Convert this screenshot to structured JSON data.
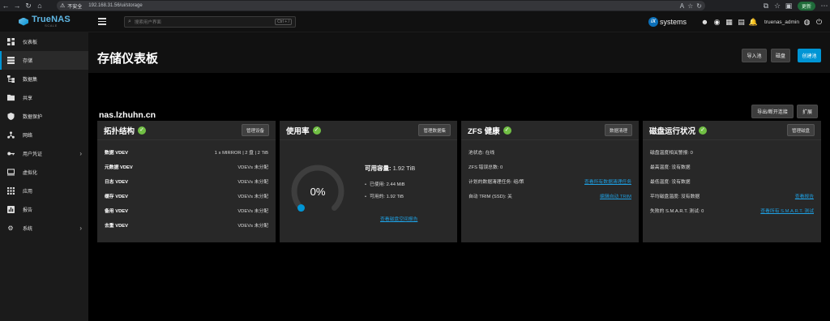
{
  "browser": {
    "security_label": "不安全",
    "url": "192.168.31.56/ui/storage",
    "update_label": "更新"
  },
  "topbar": {
    "logo_name": "TrueNAS",
    "logo_sub": "SCALE",
    "search_placeholder": "搜索用户界面",
    "search_shortcut": "Ctrl + /",
    "brand_ix": "iX",
    "brand_text": "systems",
    "username": "truenas_admin"
  },
  "sidebar": {
    "items": [
      {
        "label": "仪表板",
        "icon": "dashboard-icon"
      },
      {
        "label": "存储",
        "icon": "storage-icon",
        "active": true
      },
      {
        "label": "数据集",
        "icon": "datasets-icon"
      },
      {
        "label": "共享",
        "icon": "shares-icon"
      },
      {
        "label": "数据保护",
        "icon": "data-protection-icon"
      },
      {
        "label": "网络",
        "icon": "network-icon"
      },
      {
        "label": "用户凭证",
        "icon": "credentials-icon",
        "expandable": true
      },
      {
        "label": "虚拟化",
        "icon": "virtualization-icon"
      },
      {
        "label": "应用",
        "icon": "apps-icon"
      },
      {
        "label": "报告",
        "icon": "reporting-icon"
      },
      {
        "label": "系统",
        "icon": "system-icon",
        "expandable": true
      }
    ]
  },
  "page": {
    "title": "存储仪表板",
    "import_pool": "导入池",
    "disks": "磁盘",
    "create_pool": "创建池",
    "pool_name": "nas.lzhuhn.cn",
    "export_disconnect": "导出/断开连接",
    "expand": "扩展"
  },
  "topology": {
    "title": "拓扑结构",
    "button": "管理设备",
    "rows": [
      {
        "label": "数据 VDEV",
        "value": "1 x MIRROR | 2 盘 | 2 TiB"
      },
      {
        "label": "元数据 VDEV",
        "value": "VDEVs 未分配"
      },
      {
        "label": "日志 VDEV",
        "value": "VDEVs 未分配"
      },
      {
        "label": "缓存 VDEV",
        "value": "VDEVs 未分配"
      },
      {
        "label": "备用 VDEV",
        "value": "VDEVs 未分配"
      },
      {
        "label": "去重 VDEV",
        "value": "VDEVs 未分配"
      }
    ]
  },
  "usage": {
    "title": "使用率",
    "button": "管理数据集",
    "percent": "0%",
    "percent_value": 0,
    "capacity_label": "可用容量:",
    "capacity_value": "1.92 TiB",
    "used": "已使用: 2.44 MiB",
    "available": "可用的: 1.92 TiB",
    "link": "查看磁盘空间报告"
  },
  "zfs": {
    "title": "ZFS 健康",
    "button": "数据清理",
    "rows": [
      {
        "label": "池状态: 在线",
        "link": ""
      },
      {
        "label": "ZFS 错误总数: 0",
        "link": ""
      },
      {
        "label": "计划的数据清理任务: 组/策",
        "link": "查看所有数据清理任务"
      },
      {
        "label": "自动 TRIM (SSD): 关",
        "link": "编辑自动 TRIM"
      }
    ]
  },
  "disk_health": {
    "title": "磁盘运行状况",
    "button": "管理磁盘",
    "rows": [
      {
        "label": "磁盘温度相关警报: 0",
        "link": ""
      },
      {
        "label": "最高温度: 没有数据",
        "link": ""
      },
      {
        "label": "最低温度: 没有数据",
        "link": ""
      },
      {
        "label": "平均磁盘温度: 没有数据",
        "link": "查看报告"
      },
      {
        "label": "失败的 S.M.A.R.T. 测试: 0",
        "link": "查看所有 S.M.A.R.T. 测试"
      }
    ]
  },
  "colors": {
    "accent": "#0095d5",
    "healthy": "#71bf44",
    "card_bg": "#282828",
    "link": "#1e9ee0"
  }
}
